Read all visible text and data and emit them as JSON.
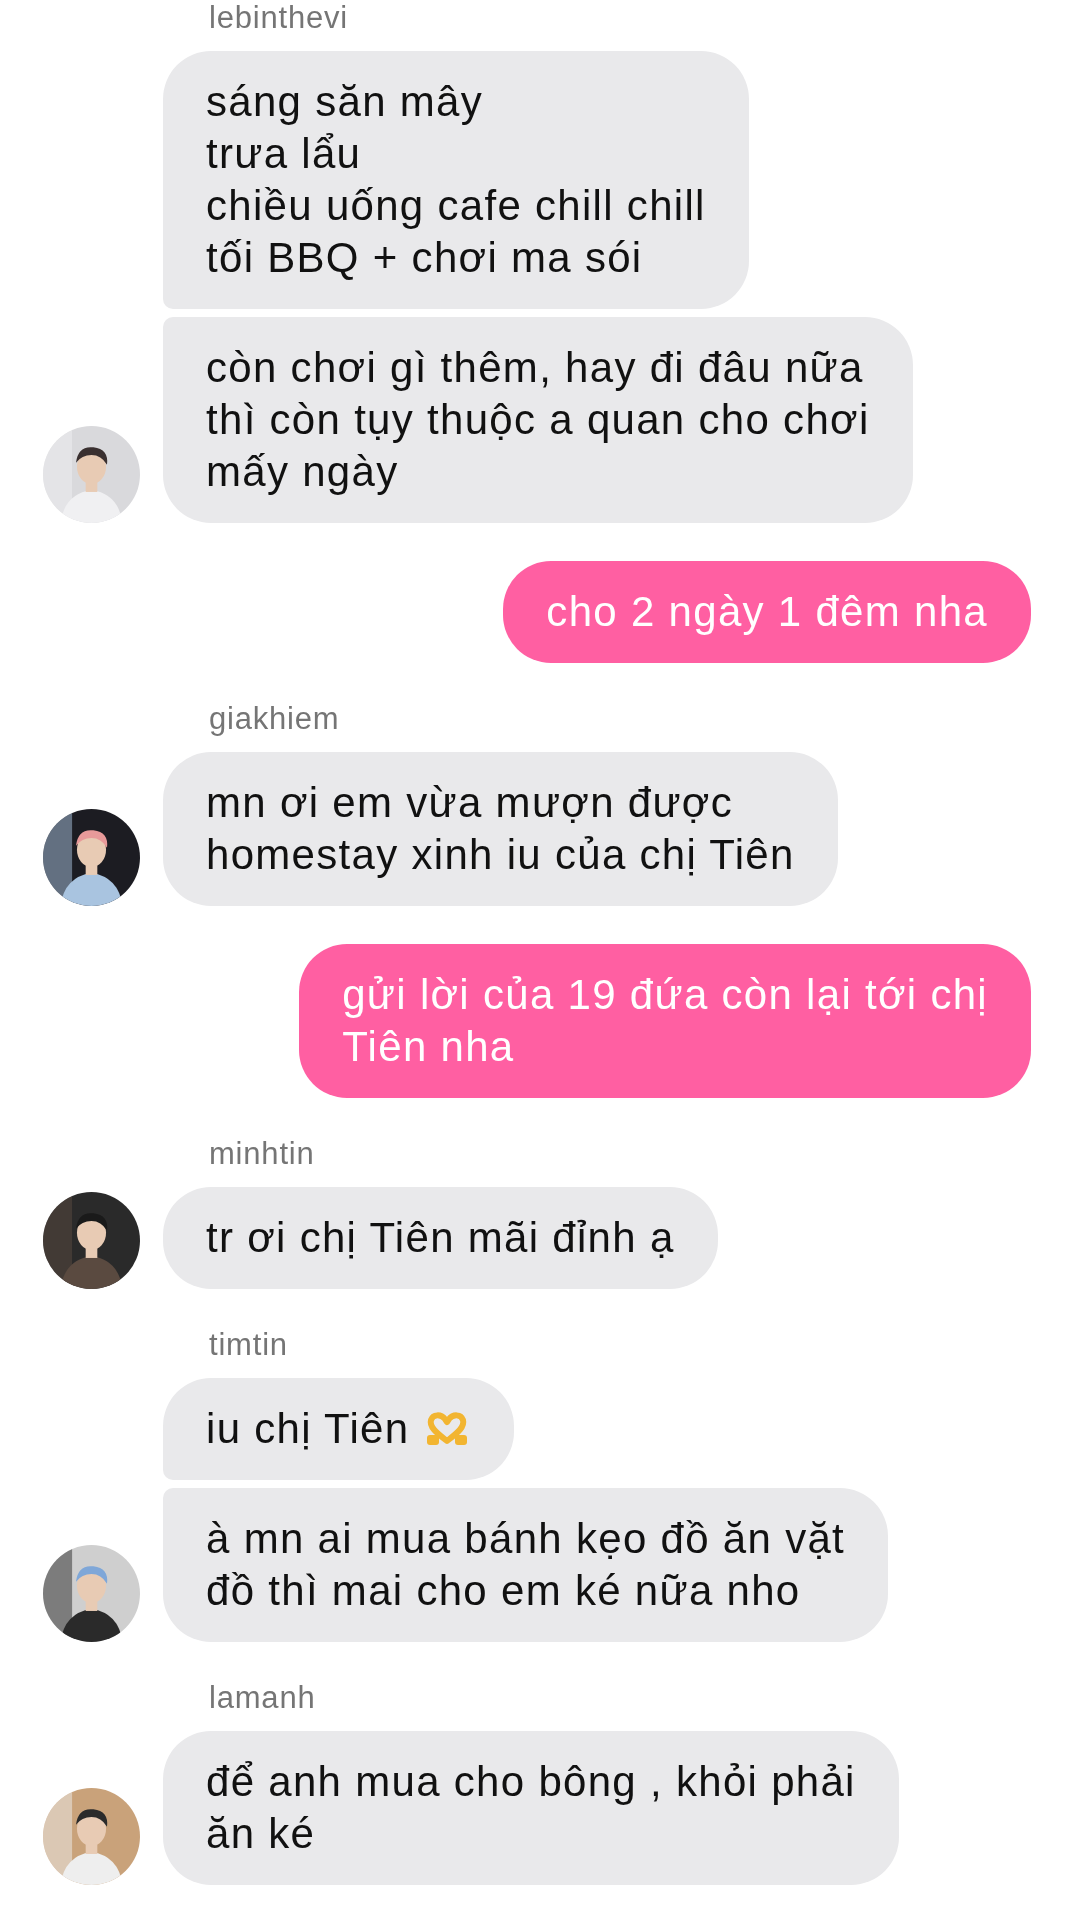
{
  "messages": [
    {
      "kind": "incoming",
      "sender": "lebinthevi",
      "bubbles": [
        {
          "kind": "text",
          "text": "sáng săn mây\ntrưa lẩu\nchiều uống cafe chill chill\ntối BBQ + chơi ma sói"
        },
        {
          "kind": "text",
          "text": "còn chơi gì thêm, hay đi đâu nữa\nthì còn tụy thuộc a quan cho chơi\nmấy ngày"
        }
      ]
    },
    {
      "kind": "outgoing",
      "bubbles": [
        {
          "kind": "text",
          "text": "cho 2 ngày 1 đêm nha"
        }
      ]
    },
    {
      "kind": "incoming",
      "sender": "giakhiem",
      "bubbles": [
        {
          "kind": "text",
          "text": "mn ơi em vừa mượn được\nhomestay xinh iu của chị Tiên"
        }
      ]
    },
    {
      "kind": "outgoing",
      "bubbles": [
        {
          "kind": "text",
          "text": "gửi lời của 19 đứa còn lại tới chị\nTiên nha"
        }
      ]
    },
    {
      "kind": "incoming",
      "sender": "minhtin",
      "bubbles": [
        {
          "kind": "text",
          "text": "tr ơi chị Tiên mãi đỉnh ạ"
        }
      ]
    },
    {
      "kind": "incoming",
      "sender": "timtin",
      "bubbles": [
        {
          "kind": "text_emoji",
          "text": "iu chị Tiên"
        },
        {
          "kind": "text",
          "text": "à mn ai mua bánh kẹo đồ ăn vặt\nđồ thì mai cho em ké nữa nho"
        }
      ]
    },
    {
      "kind": "incoming",
      "sender": "lamanh",
      "bubbles": [
        {
          "kind": "text",
          "text": "để anh mua cho bông , khỏi phải\năn ké"
        }
      ]
    }
  ]
}
